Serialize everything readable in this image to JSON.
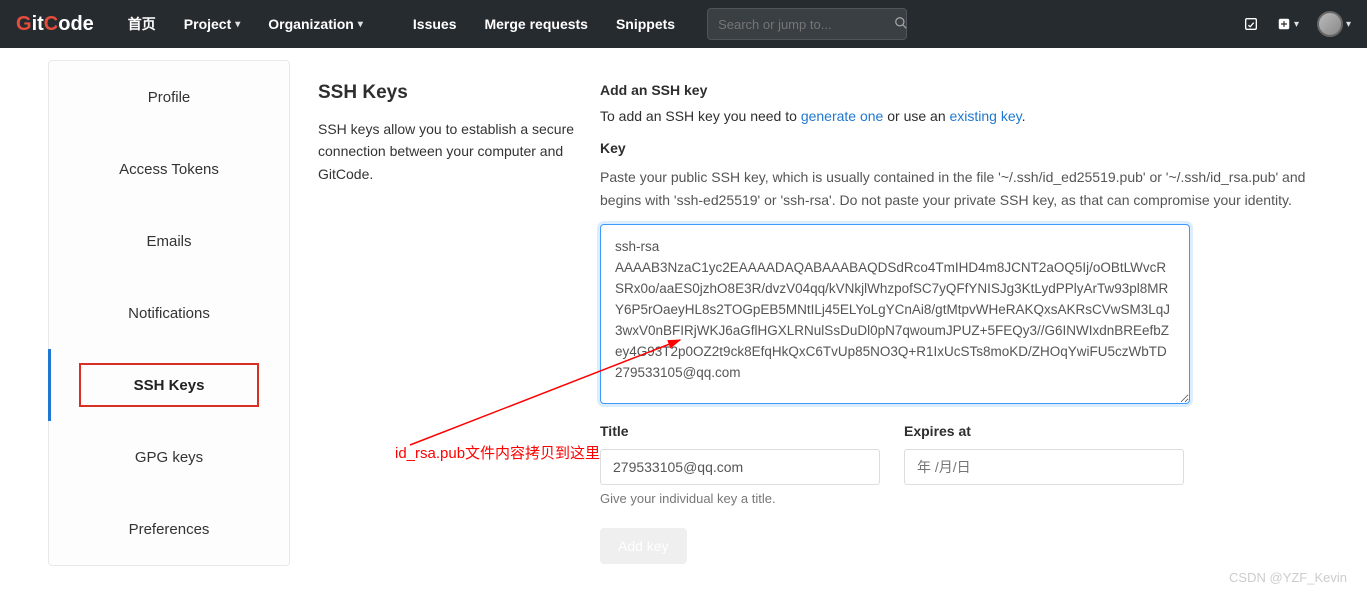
{
  "brand": "GitCode",
  "nav": {
    "home": "首页",
    "project": "Project",
    "org": "Organization",
    "issues": "Issues",
    "mr": "Merge requests",
    "snip": "Snippets"
  },
  "search": {
    "placeholder": "Search or jump to..."
  },
  "sidebar": {
    "items": [
      {
        "label": "Profile"
      },
      {
        "label": "Access Tokens"
      },
      {
        "label": "Emails"
      },
      {
        "label": "Notifications"
      },
      {
        "label": "SSH Keys",
        "active": true
      },
      {
        "label": "GPG keys"
      },
      {
        "label": "Preferences"
      }
    ]
  },
  "mid": {
    "title": "SSH Keys",
    "desc": "SSH keys allow you to establish a secure connection between your computer and GitCode."
  },
  "main": {
    "add_title": "Add an SSH key",
    "add_pre": "To add an SSH key you need to ",
    "gen": "generate one",
    "add_mid": " or use an ",
    "exist": "existing key",
    "dot": ".",
    "key_label": "Key",
    "key_help": "Paste your public SSH key, which is usually contained in the file '~/.ssh/id_ed25519.pub' or '~/.ssh/id_rsa.pub' and begins with 'ssh-ed25519' or 'ssh-rsa'. Do not paste your private SSH key, as that can compromise your identity.",
    "key_value": "ssh-rsa AAAAB3NzaC1yc2EAAAADAQABAAABAQDSdRco4TmIHD4m8JCNT2aOQ5Ij/oOBtLWvcRSRx0o/aaES0jzhO8E3R/dvzV04qq/kVNkjlWhzpofSC7yQFfYNISJg3KtLydPPlyArTw93pl8MRY6P5rOaeyHL8s2TOGpEB5MNtILj45ELYoLgYCnAi8/gtMtpvWHeRAKQxsAKRsCVwSM3LqJ3wxV0nBFIRjWKJ6aGflHGXLRNulSsDuDl0pN7qwoumJPUZ+5FEQy3//G6INWIxdnBREefbZey4G93T2p0OZ2t9ck8EfqHkQxC6TvUp85NO3Q+R1IxUcSTs8moKD/ZHOqYwiFU5czWbTD 279533105@qq.com",
    "title_label": "Title",
    "title_value": "279533105@qq.com",
    "title_tip": "Give your individual key a title.",
    "exp_label": "Expires at",
    "exp_placeholder": "年 /月/日",
    "btn": "Add key"
  },
  "annot": "id_rsa.pub文件内容拷贝到这里",
  "watermark": "CSDN @YZF_Kevin"
}
